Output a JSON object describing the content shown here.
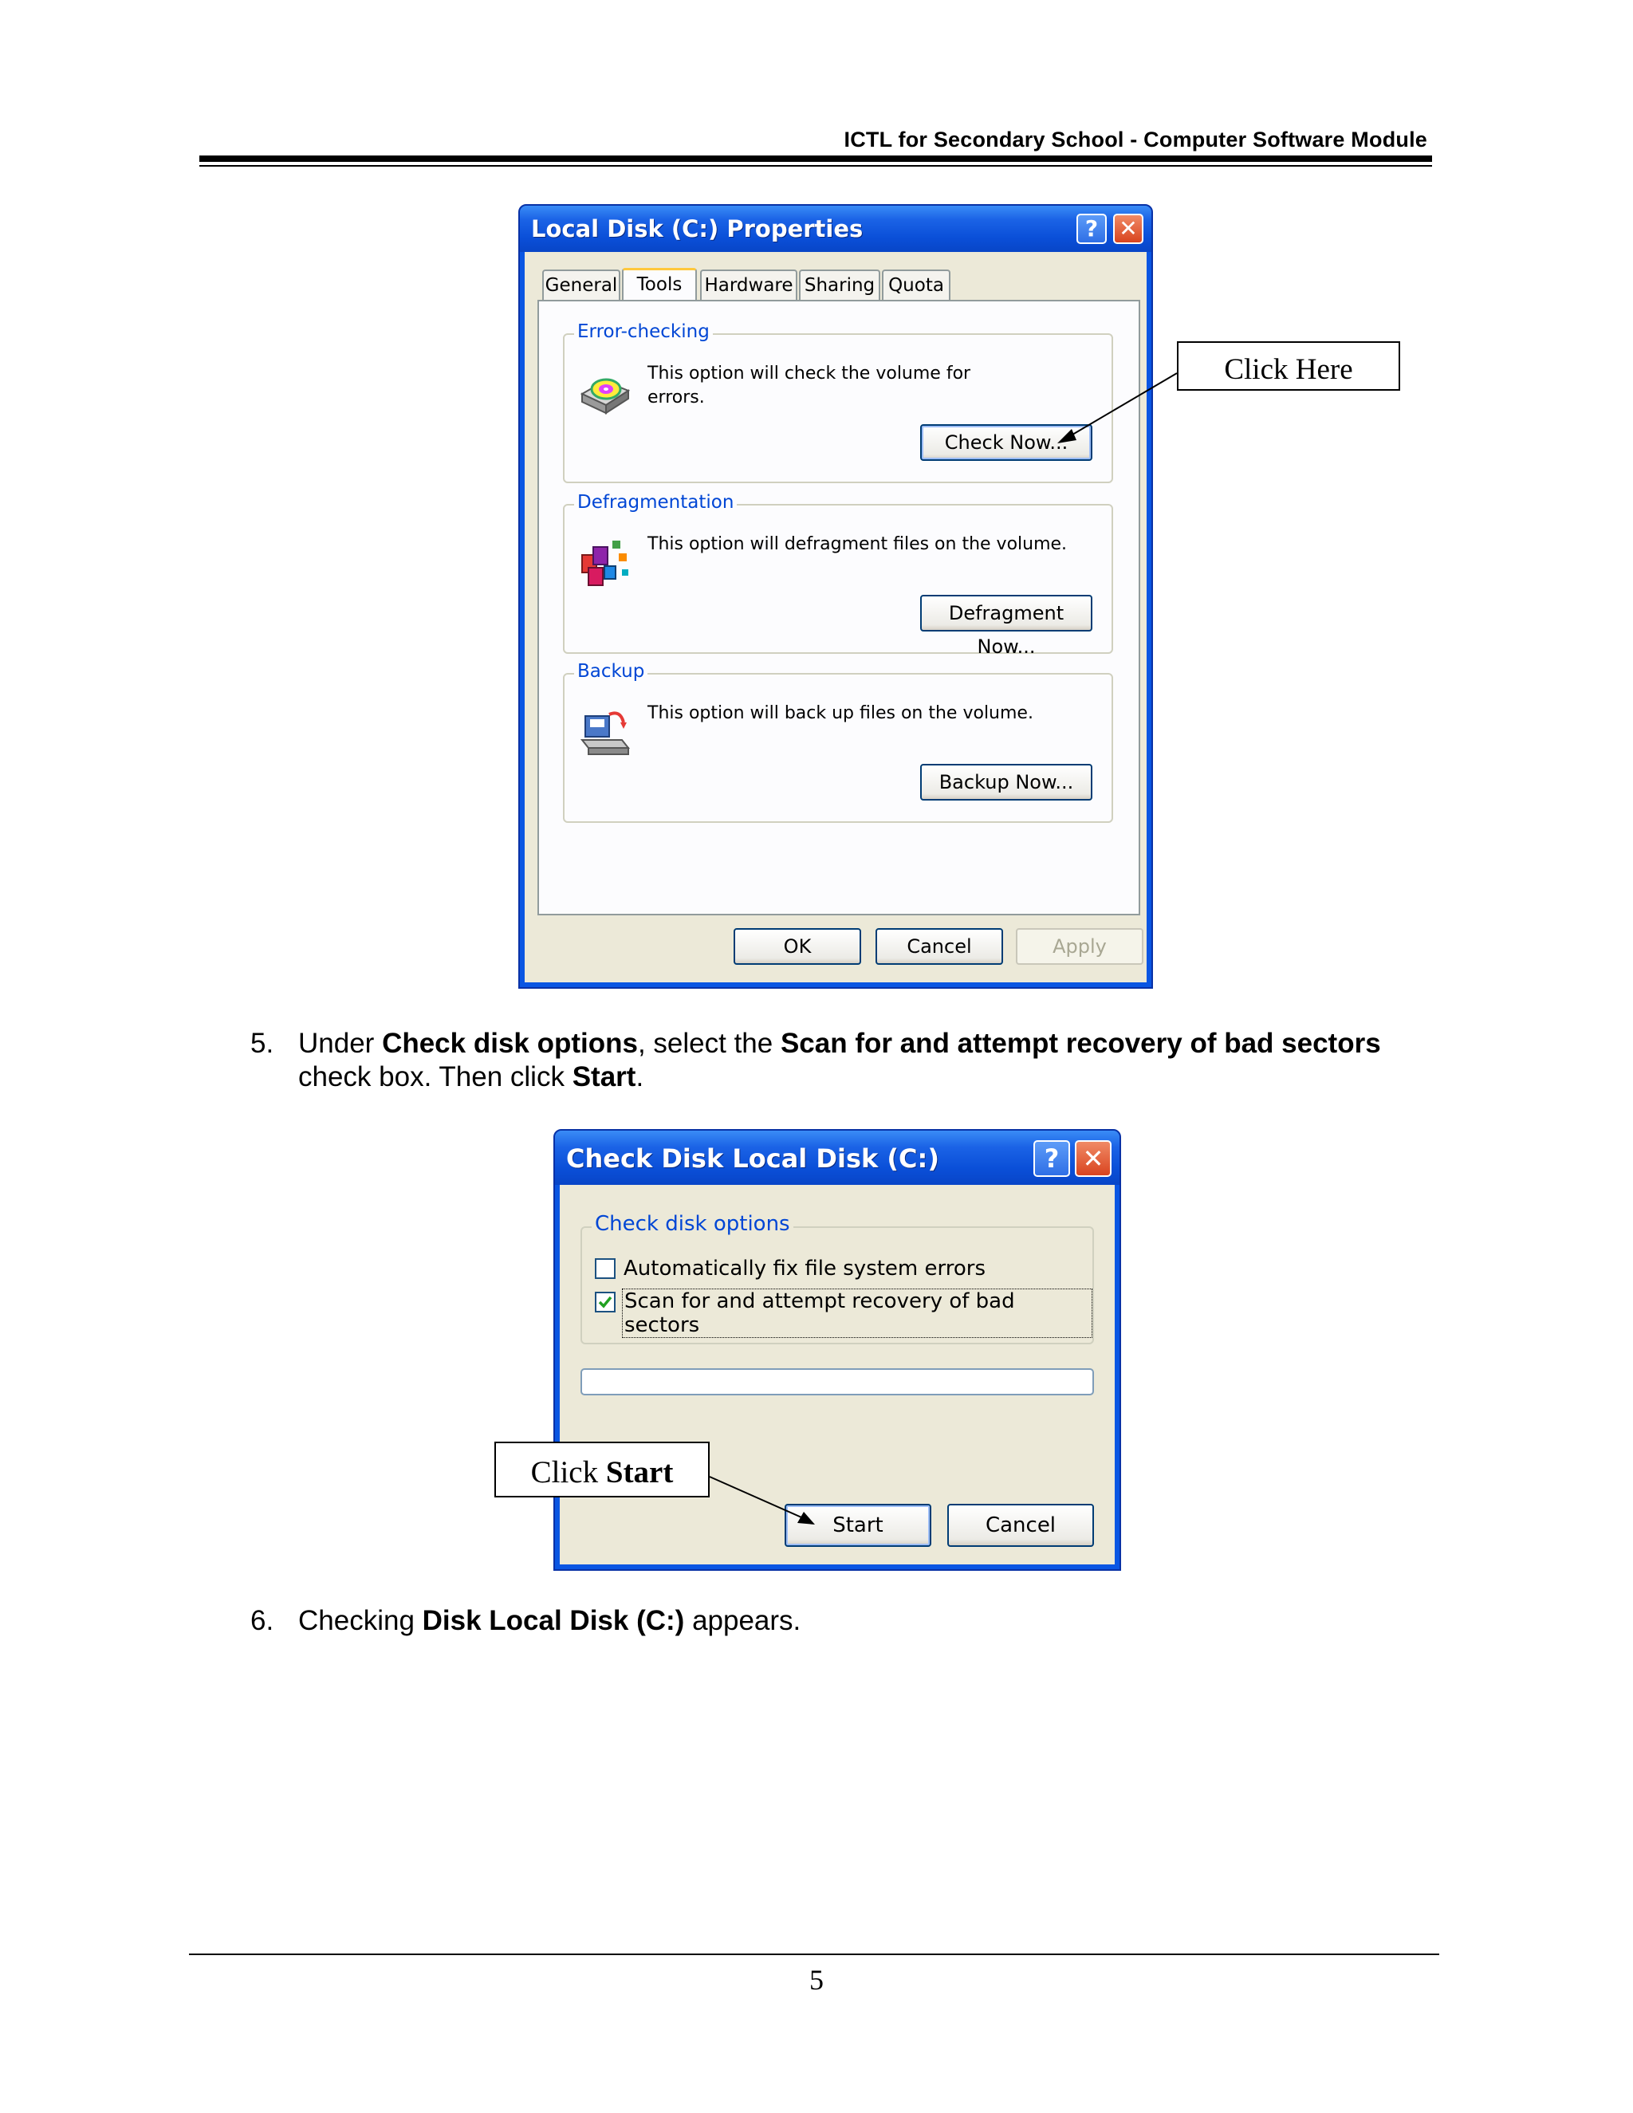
{
  "header": {
    "text": "ICTL for Secondary School - Computer Software Module"
  },
  "properties_dialog": {
    "title": "Local Disk (C:) Properties",
    "help_glyph": "?",
    "close_glyph": "✕",
    "tabs": [
      "General",
      "Tools",
      "Hardware",
      "Sharing",
      "Quota"
    ],
    "active_tab": "Tools",
    "error_checking": {
      "label": "Error-checking",
      "text": "This option will check the volume for errors.",
      "button": "Check Now..."
    },
    "defragmentation": {
      "label": "Defragmentation",
      "text": "This option will defragment files on the volume.",
      "button": "Defragment Now..."
    },
    "backup": {
      "label": "Backup",
      "text": "This option will back up files on the volume.",
      "button": "Backup Now..."
    },
    "ok": "OK",
    "cancel": "Cancel",
    "apply": "Apply"
  },
  "callout_click_here": "Click Here",
  "step5": {
    "number": "5.",
    "parts": [
      "Under ",
      "Check disk options",
      ", select the ",
      "Scan for and attempt recovery of bad sectors",
      " check box. Then click ",
      "Start",
      "."
    ]
  },
  "check_disk_dialog": {
    "title": "Check Disk Local Disk (C:)",
    "help_glyph": "?",
    "close_glyph": "✕",
    "group_label": "Check disk options",
    "option1": {
      "label": "Automatically fix file system errors",
      "checked": false
    },
    "option2": {
      "label": "Scan for and attempt recovery of bad sectors",
      "checked": true
    },
    "progress_percent": 0,
    "start": "Start",
    "cancel": "Cancel"
  },
  "callout_click_start": {
    "prefix": "Click ",
    "bold": "Start"
  },
  "step6": {
    "number": "6.",
    "parts": [
      "Checking ",
      "Disk Local Disk (C:)",
      " appears."
    ]
  },
  "page_number": "5"
}
